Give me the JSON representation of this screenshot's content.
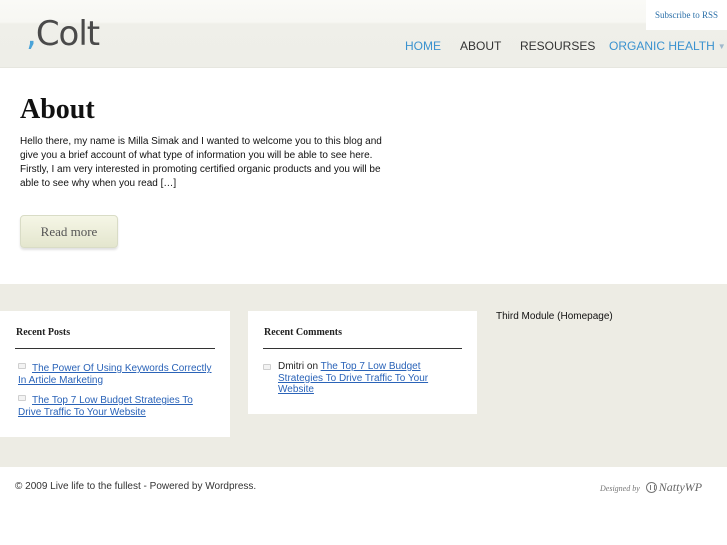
{
  "header": {
    "logo_text": "Colt",
    "logo_mark": ",",
    "rss_label": "Subscribe to RSS",
    "nav": [
      {
        "label": "HOME",
        "active": true
      },
      {
        "label": "ABOUT",
        "active": false
      },
      {
        "label": "RESOURSES",
        "active": false
      },
      {
        "label": "ORGANIC HEALTH",
        "active": false,
        "has_dropdown": true
      }
    ],
    "dropdown_caret": "▼"
  },
  "post": {
    "title": "About",
    "excerpt": "Hello there, my name is Milla Simak and I wanted to welcome you to this blog and give you a brief account of what type of information you will be able to see here. Firstly, I am very interested in promoting certified organic products and you will be able to see why when you read […]",
    "read_more_label": "Read more"
  },
  "widgets": {
    "recent_posts": {
      "title": "Recent Posts",
      "items": [
        "The Power Of Using Keywords Correctly In Article Marketing",
        "The Top 7 Low Budget Strategies To Drive Traffic To Your Website"
      ]
    },
    "recent_comments": {
      "title": "Recent Comments",
      "items": [
        {
          "author": "Dmitri",
          "connector": "on",
          "post": "The Top 7 Low Budget Strategies To Drive Traffic To Your Website"
        }
      ]
    },
    "third_module": "Third Module (Homepage)"
  },
  "footer": {
    "copyright": "© 2009 Live life to the fullest - Powered by Wordpress.",
    "designed_by": "Designed by",
    "designer": "NattyWP"
  },
  "colors": {
    "accent_blue": "#3a92cf",
    "link_blue": "#2a63b8",
    "band_bg": "#edece4"
  }
}
